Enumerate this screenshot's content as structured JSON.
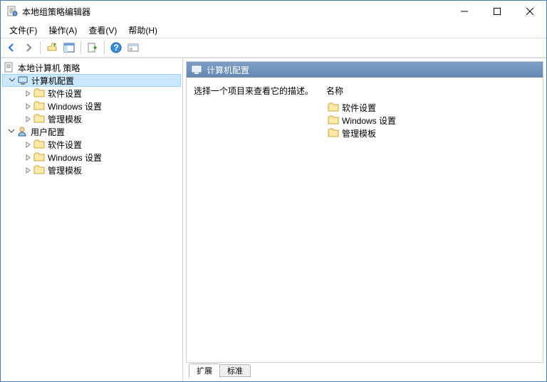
{
  "window": {
    "title": "本地组策略编辑器"
  },
  "menubar": {
    "file": "文件(F)",
    "action": "操作(A)",
    "view": "查看(V)",
    "help": "帮助(H)"
  },
  "tree": {
    "root": "本地计算机 策略",
    "computer": "计算机配置",
    "user": "用户配置",
    "software": "软件设置",
    "windows": "Windows 设置",
    "templates": "管理模板"
  },
  "detail": {
    "header": "计算机配置",
    "prompt": "选择一个项目来查看它的描述。",
    "nameCol": "名称",
    "items": {
      "software": "软件设置",
      "windows": "Windows 设置",
      "templates": "管理模板"
    }
  },
  "tabs": {
    "extended": "扩展",
    "standard": "标准"
  }
}
